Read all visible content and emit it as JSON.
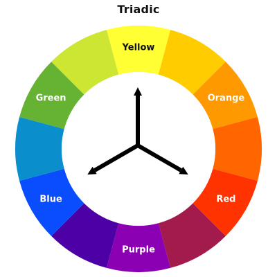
{
  "title": "Triadic",
  "wheel": {
    "segments": [
      {
        "color": "#FFFF33",
        "label": "Yellow",
        "label_color": "#111111"
      },
      {
        "color": "#FFCC00",
        "label": "",
        "label_color": "#ffffff"
      },
      {
        "color": "#FF9900",
        "label": "Orange",
        "label_color": "#ffffff"
      },
      {
        "color": "#FF6600",
        "label": "",
        "label_color": "#ffffff"
      },
      {
        "color": "#FF3300",
        "label": "Red",
        "label_color": "#ffffff"
      },
      {
        "color": "#A31A4D",
        "label": "",
        "label_color": "#ffffff"
      },
      {
        "color": "#8C00B3",
        "label": "Purple",
        "label_color": "#ffffff"
      },
      {
        "color": "#4D00A6",
        "label": "",
        "label_color": "#ffffff"
      },
      {
        "color": "#0A4DFF",
        "label": "Blue",
        "label_color": "#ffffff"
      },
      {
        "color": "#0A8FCC",
        "label": "",
        "label_color": "#ffffff"
      },
      {
        "color": "#66B333",
        "label": "Green",
        "label_color": "#ffffff"
      },
      {
        "color": "#CCE633",
        "label": "",
        "label_color": "#ffffff"
      }
    ]
  },
  "arrows": {
    "color": "#000000",
    "targets": [
      "Yellow",
      "Red",
      "Blue"
    ]
  }
}
